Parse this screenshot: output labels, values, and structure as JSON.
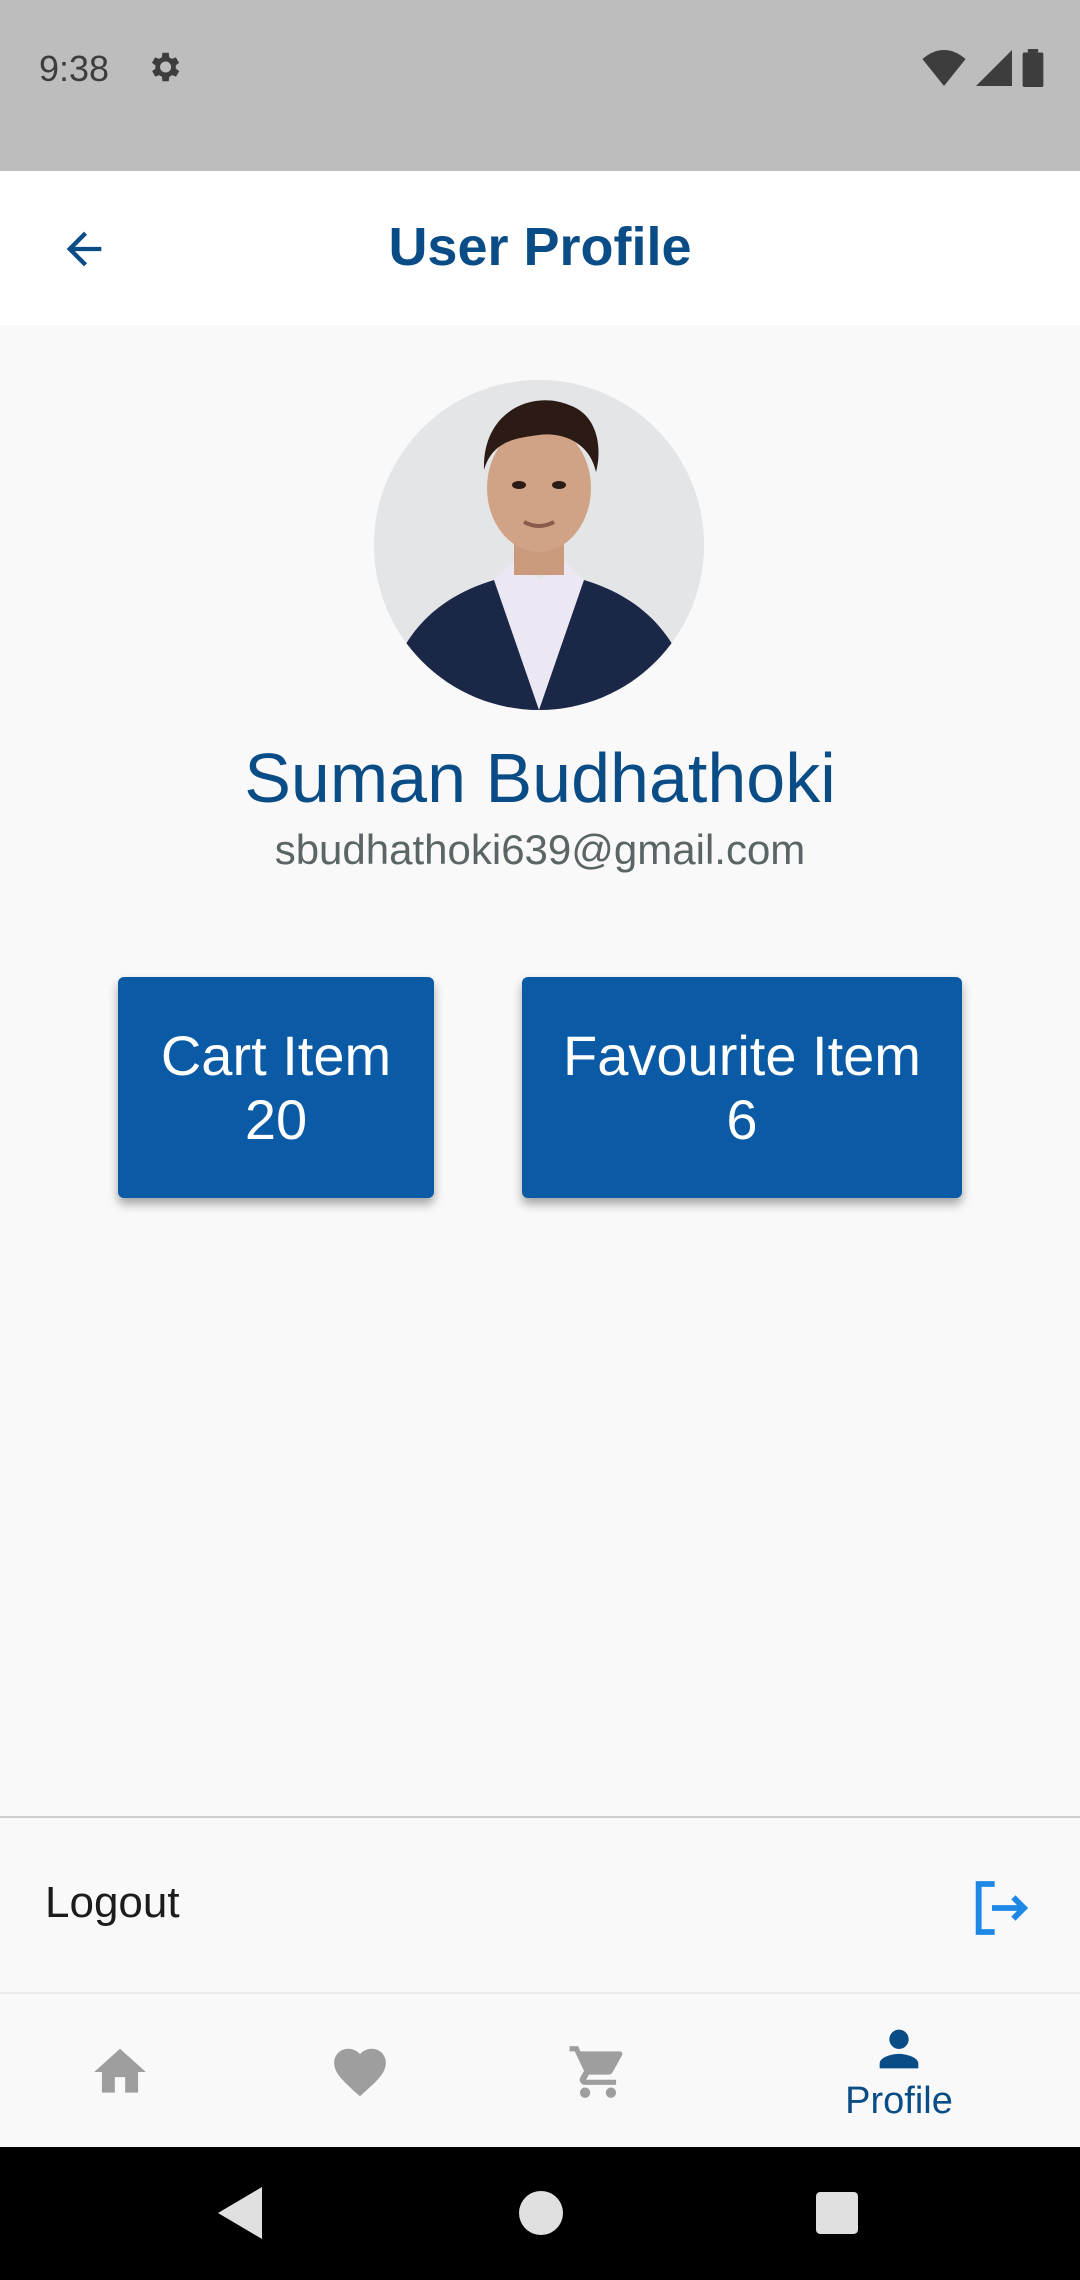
{
  "status_bar": {
    "time": "9:38"
  },
  "app_bar": {
    "title": "User Profile"
  },
  "profile": {
    "name": "Suman Budhathoki",
    "email": "sbudhathoki639@gmail.com"
  },
  "stats": {
    "cart": {
      "label": "Cart Item",
      "count": "20"
    },
    "favourite": {
      "label": "Favourite Item",
      "count": "6"
    }
  },
  "logout": {
    "label": "Logout"
  },
  "bottom_nav": {
    "items": [
      {
        "icon": "home-icon",
        "label": ""
      },
      {
        "icon": "heart-icon",
        "label": ""
      },
      {
        "icon": "cart-icon",
        "label": ""
      },
      {
        "icon": "person-icon",
        "label": "Profile",
        "active": true
      }
    ]
  },
  "colors": {
    "primary": "#0a4c86",
    "card": "#0b5aa6",
    "accent": "#1e88e5",
    "inactive_icon": "#9e9e9e"
  }
}
